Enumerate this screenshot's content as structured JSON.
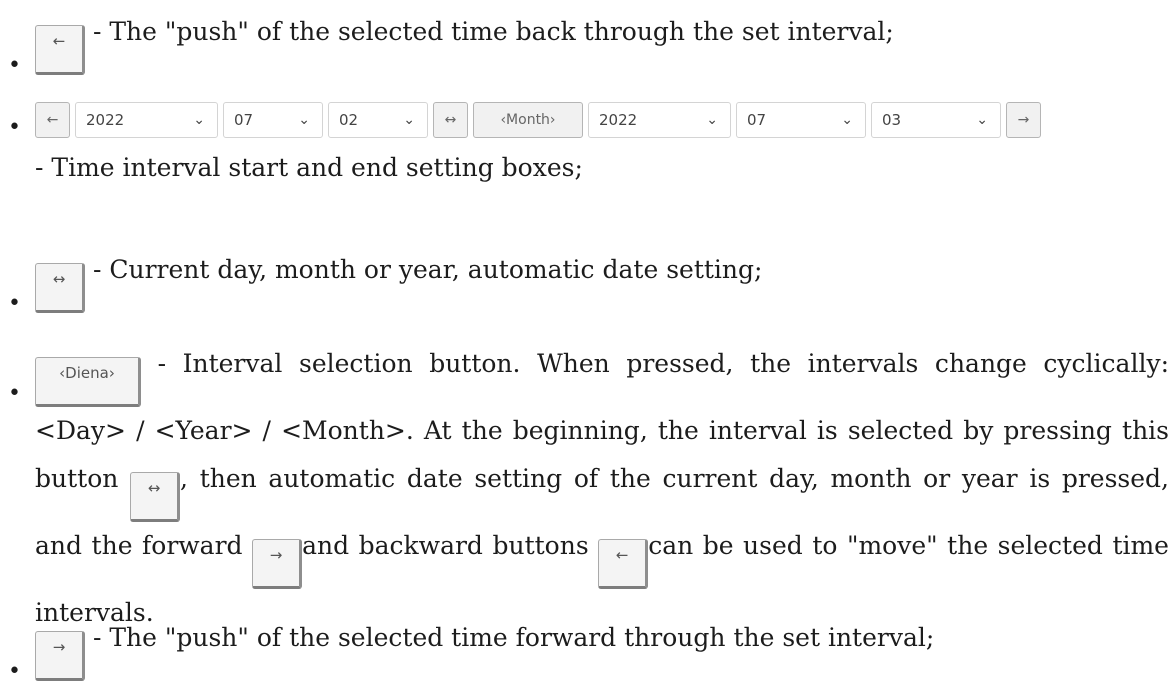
{
  "items": [
    {
      "text": " - The \"push\" of the selected time back through the set interval;",
      "button_icon": "←"
    },
    {
      "controls": {
        "back_icon": "←",
        "start_year": "2022",
        "start_month": "07",
        "start_day": "02",
        "auto_icon": "↔",
        "interval_label": "‹Month›",
        "end_year": "2022",
        "end_month": "07",
        "end_day": "03",
        "forward_icon": "→",
        "chevron": "⌄"
      },
      "text": "- Time interval start and end setting boxes;"
    },
    {
      "text": " - Current day, month or year, automatic date setting;",
      "button_icon": "↔"
    },
    {
      "button_label": "‹Diena›",
      "text_a": " - Interval selection button. When pressed, the intervals change cyclically: <Day> / <Year> / <Month>. At the beginning, the interval is selected by pressing this button ",
      "inline_icon_1": "↔",
      "text_b": ", then automatic date setting of the current day, month or year is pressed, and the forward ",
      "inline_icon_2": "→",
      "text_c": "and backward buttons ",
      "inline_icon_3": "←",
      "text_d": "can be used to \"move\" the selected time intervals."
    },
    {
      "text": " - The \"push\" of the selected time forward through the set interval;",
      "button_icon": "→"
    }
  ],
  "bullet": "•"
}
